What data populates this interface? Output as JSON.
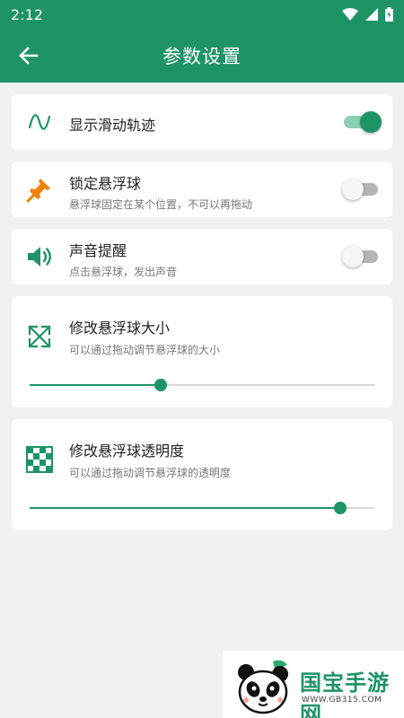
{
  "status_bar": {
    "time": "2:12"
  },
  "app_bar": {
    "title": "参数设置"
  },
  "settings": {
    "trail": {
      "title": "显示滑动轨迹",
      "enabled": true
    },
    "lock": {
      "title": "锁定悬浮球",
      "subtitle": "悬浮球固定在某个位置，不可以再拖动",
      "enabled": false
    },
    "sound": {
      "title": "声音提醒",
      "subtitle": "点击悬浮球，发出声音",
      "enabled": false
    },
    "size": {
      "title": "修改悬浮球大小",
      "subtitle": "可以通过拖动调节悬浮球的大小",
      "value": 0.38
    },
    "opacity": {
      "title": "修改悬浮球透明度",
      "subtitle": "可以通过拖动调节悬浮球的透明度",
      "value": 0.9
    }
  },
  "watermark": {
    "brand": "国宝手游网",
    "url": "WWW.GB315.COM"
  },
  "colors": {
    "primary": "#1e9466",
    "pin": "#f08200"
  }
}
